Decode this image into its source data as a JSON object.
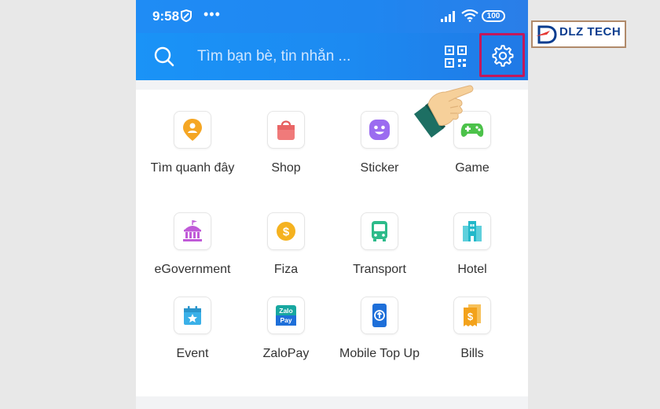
{
  "status_bar": {
    "time": "9:58",
    "dots": "•••",
    "battery": "100"
  },
  "search": {
    "placeholder": "Tìm bạn bè, tin nhắn ..."
  },
  "logo": {
    "text": "DLZ TECH",
    "icon": "dlz-logo-mark"
  },
  "colors": {
    "header_blue": "#1c8af1",
    "highlight_border": "#c2185b",
    "logo_blue": "#0a3d8f"
  },
  "apps": [
    {
      "label": "Tìm quanh đây",
      "icon": "location-person-icon",
      "color": "#f5a623"
    },
    {
      "label": "Shop",
      "icon": "shopping-bag-icon",
      "color": "#f06b6b"
    },
    {
      "label": "Sticker",
      "icon": "smiley-sticker-icon",
      "color": "#9b6cf0"
    },
    {
      "label": "Game",
      "icon": "gamepad-icon",
      "color": "#4cc24a"
    },
    {
      "label": "eGovernment",
      "icon": "government-building-icon",
      "color": "#c05ad8"
    },
    {
      "label": "Fiza",
      "icon": "coin-dollar-icon",
      "color": "#f5b21f"
    },
    {
      "label": "Transport",
      "icon": "bus-icon",
      "color": "#2dbb8a"
    },
    {
      "label": "Hotel",
      "icon": "hotel-building-icon",
      "color": "#22b8c9"
    },
    {
      "label": "Event",
      "icon": "calendar-star-icon",
      "color": "#3ab0e8"
    },
    {
      "label": "ZaloPay",
      "icon": "zalopay-icon",
      "color": "#18a7a0"
    },
    {
      "label": "Mobile Top Up",
      "icon": "mobile-topup-icon",
      "color": "#1e6fd9"
    },
    {
      "label": "Bills",
      "icon": "bill-dollar-icon",
      "color": "#f3a21b"
    }
  ],
  "zalopay_icon_text": [
    "Zalo",
    "Pay"
  ]
}
